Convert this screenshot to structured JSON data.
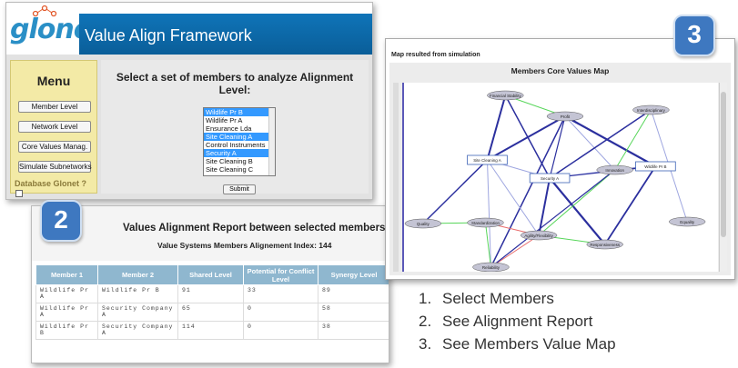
{
  "app": {
    "logo": "glonet",
    "title": "Value Align Framework"
  },
  "menu": {
    "title": "Menu",
    "items": [
      "Member Level",
      "Network Level",
      "Core Values Manag.",
      "Simulate Subnetworks"
    ],
    "db_label": "Database Glonet ?"
  },
  "selection": {
    "heading": "Select a set of members to analyze Alignment Level:",
    "options": [
      {
        "label": "Wildlife Pr B",
        "selected": true
      },
      {
        "label": "Wildlife Pr A",
        "selected": false
      },
      {
        "label": "Ensurance Lda",
        "selected": false
      },
      {
        "label": "Site Cleaning A",
        "selected": true
      },
      {
        "label": "Control Instruments",
        "selected": false
      },
      {
        "label": "Security A",
        "selected": true
      },
      {
        "label": "Site Cleaning B",
        "selected": false
      },
      {
        "label": "Site Cleaning C",
        "selected": false
      }
    ],
    "submit": "Submit"
  },
  "report": {
    "title": "Values Alignment Report between selected members",
    "index_line": "Value Systems Members Alignement Index: 144",
    "columns": [
      "Member 1",
      "Member 2",
      "Shared Level",
      "Potential for Conflict Level",
      "Synergy Level"
    ],
    "rows": [
      [
        "Wildlife Pr A",
        "Wildlife Pr B",
        "91",
        "33",
        "89"
      ],
      [
        "Wildlife Pr A",
        "Security Company A",
        "65",
        "0",
        "58"
      ],
      [
        "Wildlife Pr B",
        "Security Company A",
        "114",
        "0",
        "38"
      ]
    ]
  },
  "map": {
    "top_label": "Map resulted from simulation",
    "title": "Members Core Values Map",
    "nodes": [
      {
        "label": "Financial Stability",
        "shape": "ellipse"
      },
      {
        "label": "Profit",
        "shape": "ellipse"
      },
      {
        "label": "Interdisciplinary",
        "shape": "ellipse"
      },
      {
        "label": "Site Cleaning A",
        "shape": "rect"
      },
      {
        "label": "Security A",
        "shape": "rect"
      },
      {
        "label": "Innovation",
        "shape": "ellipse"
      },
      {
        "label": "Wildlife Pr B",
        "shape": "rect"
      },
      {
        "label": "Quality",
        "shape": "ellipse"
      },
      {
        "label": "Standardization",
        "shape": "ellipse"
      },
      {
        "label": "Agility/Flexibility",
        "shape": "ellipse"
      },
      {
        "label": "Responsiveness",
        "shape": "ellipse"
      },
      {
        "label": "Equality",
        "shape": "ellipse"
      },
      {
        "label": "Reliability",
        "shape": "ellipse"
      }
    ],
    "edge_colors": {
      "strong": "#2b2f9e",
      "weak": "#9ea6e0",
      "synergy": "#57d65a",
      "conflict": "#e86a6a"
    }
  },
  "badges": [
    "1",
    "2",
    "3"
  ],
  "steps": [
    {
      "num": "1.",
      "text": "Select Members"
    },
    {
      "num": "2.",
      "text": "See Alignment Report"
    },
    {
      "num": "3.",
      "text": "See Members Value Map"
    }
  ]
}
